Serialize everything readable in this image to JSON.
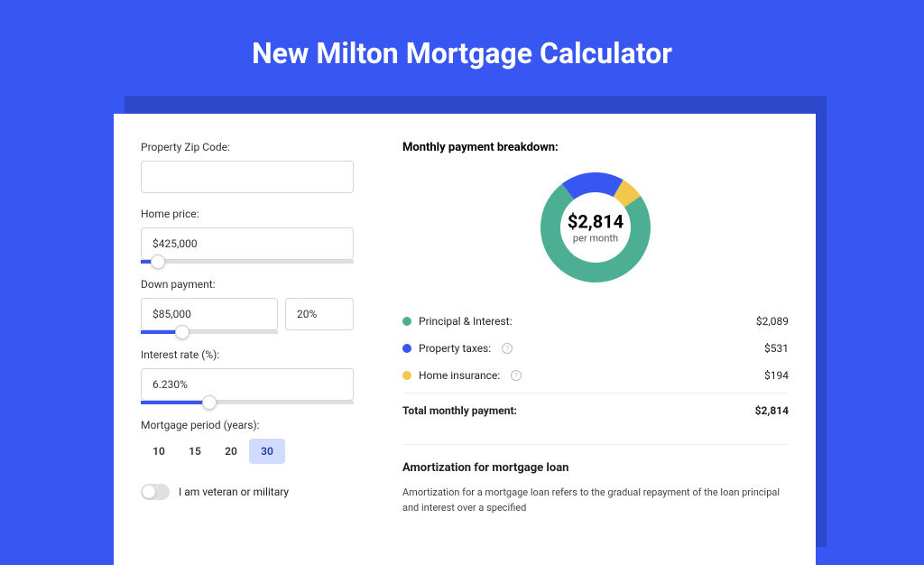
{
  "page_title": "New Milton Mortgage Calculator",
  "form": {
    "zip_label": "Property Zip Code:",
    "zip_value": "",
    "home_price_label": "Home price:",
    "home_price_value": "$425,000",
    "home_price_slider_pct": 8,
    "down_payment_label": "Down payment:",
    "down_payment_value": "$85,000",
    "down_payment_pct": "20%",
    "down_payment_slider_pct": 30,
    "interest_label": "Interest rate (%):",
    "interest_value": "6.230%",
    "interest_slider_pct": 32,
    "period_label": "Mortgage period (years):",
    "periods": [
      "10",
      "15",
      "20",
      "30"
    ],
    "period_active_index": 3,
    "veteran_label": "I am veteran or military"
  },
  "breakdown": {
    "title": "Monthly payment breakdown:",
    "center_amount": "$2,814",
    "center_sub": "per month",
    "items": [
      {
        "label": "Principal & Interest:",
        "value": "$2,089",
        "info": false
      },
      {
        "label": "Property taxes:",
        "value": "$531",
        "info": true
      },
      {
        "label": "Home insurance:",
        "value": "$194",
        "info": true
      }
    ],
    "total_label": "Total monthly payment:",
    "total_value": "$2,814"
  },
  "amortization": {
    "title": "Amortization for mortgage loan",
    "text": "Amortization for a mortgage loan refers to the gradual repayment of the loan principal and interest over a specified"
  },
  "chart_data": {
    "type": "pie",
    "title": "Monthly payment breakdown",
    "series": [
      {
        "name": "Principal & Interest",
        "value": 2089,
        "color": "#4caf93"
      },
      {
        "name": "Property taxes",
        "value": 531,
        "color": "#3857f2"
      },
      {
        "name": "Home insurance",
        "value": 194,
        "color": "#f2c84c"
      }
    ],
    "total": 2814,
    "center_label": "$2,814 per month"
  }
}
